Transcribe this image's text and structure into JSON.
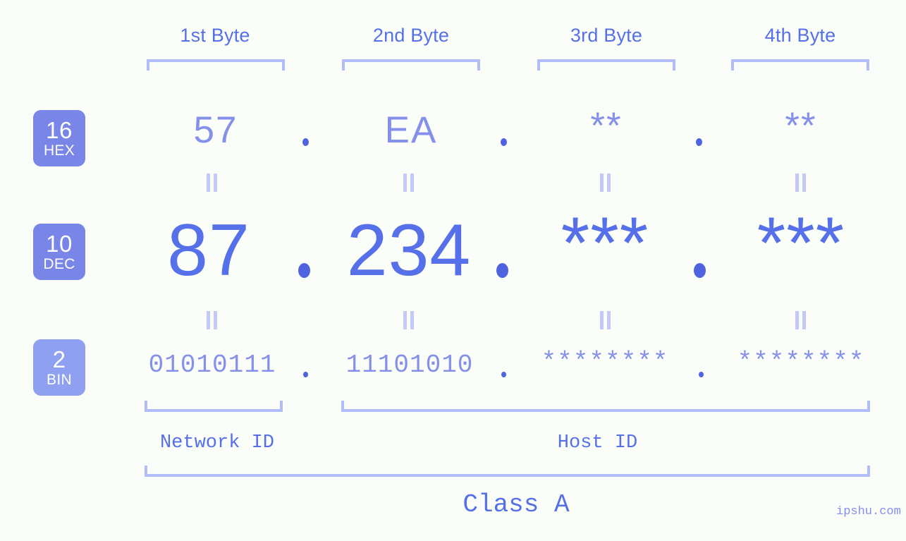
{
  "watermark": "ipshu.com",
  "byte_headers": [
    {
      "label": "1st Byte"
    },
    {
      "label": "2nd Byte"
    },
    {
      "label": "3rd Byte"
    },
    {
      "label": "4th Byte"
    }
  ],
  "bases": [
    {
      "num": "16",
      "label": "HEX",
      "color": "#7986e8"
    },
    {
      "num": "10",
      "label": "DEC",
      "color": "#7986e8"
    },
    {
      "num": "2",
      "label": "BIN",
      "color": "#8fa0f0"
    }
  ],
  "rows": {
    "hex": {
      "values": [
        "57",
        "EA",
        "**",
        "**"
      ]
    },
    "dec": {
      "values": [
        "87",
        "234",
        "***",
        "***"
      ]
    },
    "bin": {
      "values": [
        "01010111",
        "11101010",
        "********",
        "********"
      ]
    }
  },
  "separator": ".",
  "equals_symbol": "=",
  "id_labels": {
    "network": "Network ID",
    "host": "Host ID"
  },
  "class_label": "Class A",
  "colors": {
    "background": "#fafdf8",
    "bracket": "#b3bdfa",
    "accent": "#5570e8",
    "muted": "#8490ea",
    "dot": "#4f63e0",
    "equals": "#c3caf8"
  }
}
